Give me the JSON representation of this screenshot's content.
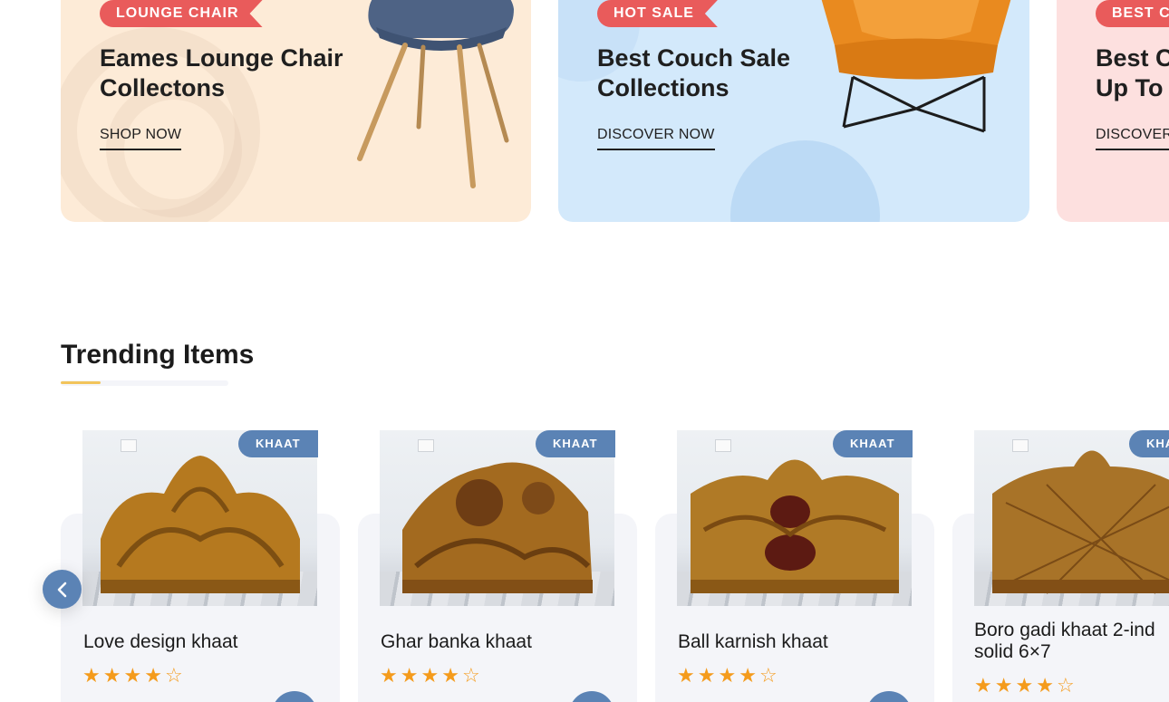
{
  "banners": [
    {
      "tag": "LOUNGE CHAIR",
      "title": "Eames Lounge Chair Collectons",
      "link": "SHOP NOW"
    },
    {
      "tag": "HOT SALE",
      "title": "Best Couch Sale Collections",
      "link": "DISCOVER NOW"
    },
    {
      "tag": "BEST C",
      "title": "Best C\nUp To",
      "link": "DISCOVER"
    }
  ],
  "section": {
    "title": "Trending Items"
  },
  "products": [
    {
      "badge": "KHAAT",
      "name": "Love design khaat",
      "rating": 4
    },
    {
      "badge": "KHAAT",
      "name": "Ghar banka khaat",
      "rating": 4
    },
    {
      "badge": "KHAAT",
      "name": "Ball karnish khaat",
      "rating": 4
    },
    {
      "badge": "KHA",
      "name": "Boro gadi khaat 2-ind solid 6×7",
      "rating": 4
    }
  ],
  "icons": {
    "prev": "chevron-left-icon",
    "star": "star-icon"
  },
  "colors": {
    "accent": "#5b83b5",
    "tag": "#e95b5b",
    "star": "#f49b1c",
    "underline": "#f2c45b"
  }
}
